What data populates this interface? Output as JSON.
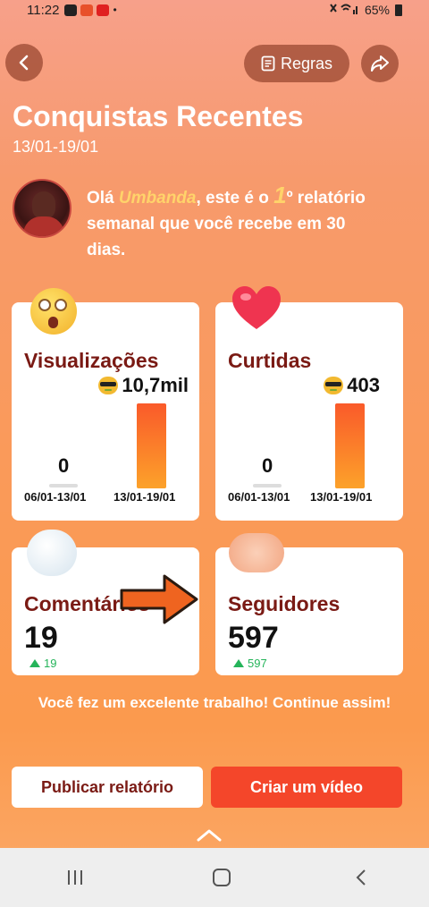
{
  "status_bar": {
    "time": "11:22",
    "battery": "65%"
  },
  "header": {
    "rules_label": "Regras"
  },
  "title": "Conquistas Recentes",
  "date_range": "13/01-19/01",
  "greeting": {
    "prefix": "Olá ",
    "username": "Umbanda",
    "middle": ", este é o ",
    "number": "1",
    "ordinal": "º",
    "suffix": " relatório semanal que você recebe em 30 dias."
  },
  "cards": {
    "views": {
      "title": "Visualizações",
      "current_value": "10,7mil",
      "previous_value": "0",
      "previous_label": "06/01-13/01",
      "current_label": "13/01-19/01"
    },
    "likes": {
      "title": "Curtidas",
      "current_value": "403",
      "previous_value": "0",
      "previous_label": "06/01-13/01",
      "current_label": "13/01-19/01"
    },
    "comments": {
      "title": "Comentários",
      "value": "19",
      "delta": "19"
    },
    "followers": {
      "title": "Seguidores",
      "value": "597",
      "delta": "597"
    }
  },
  "praise": "Você fez um excelente trabalho! Continue assim!",
  "buttons": {
    "publish": "Publicar relatório",
    "create": "Criar um vídeo"
  },
  "colors": {
    "accent": "#f4462a",
    "card_title": "#7a1a14",
    "growth": "#25b45a",
    "highlight": "#ffd36a"
  }
}
